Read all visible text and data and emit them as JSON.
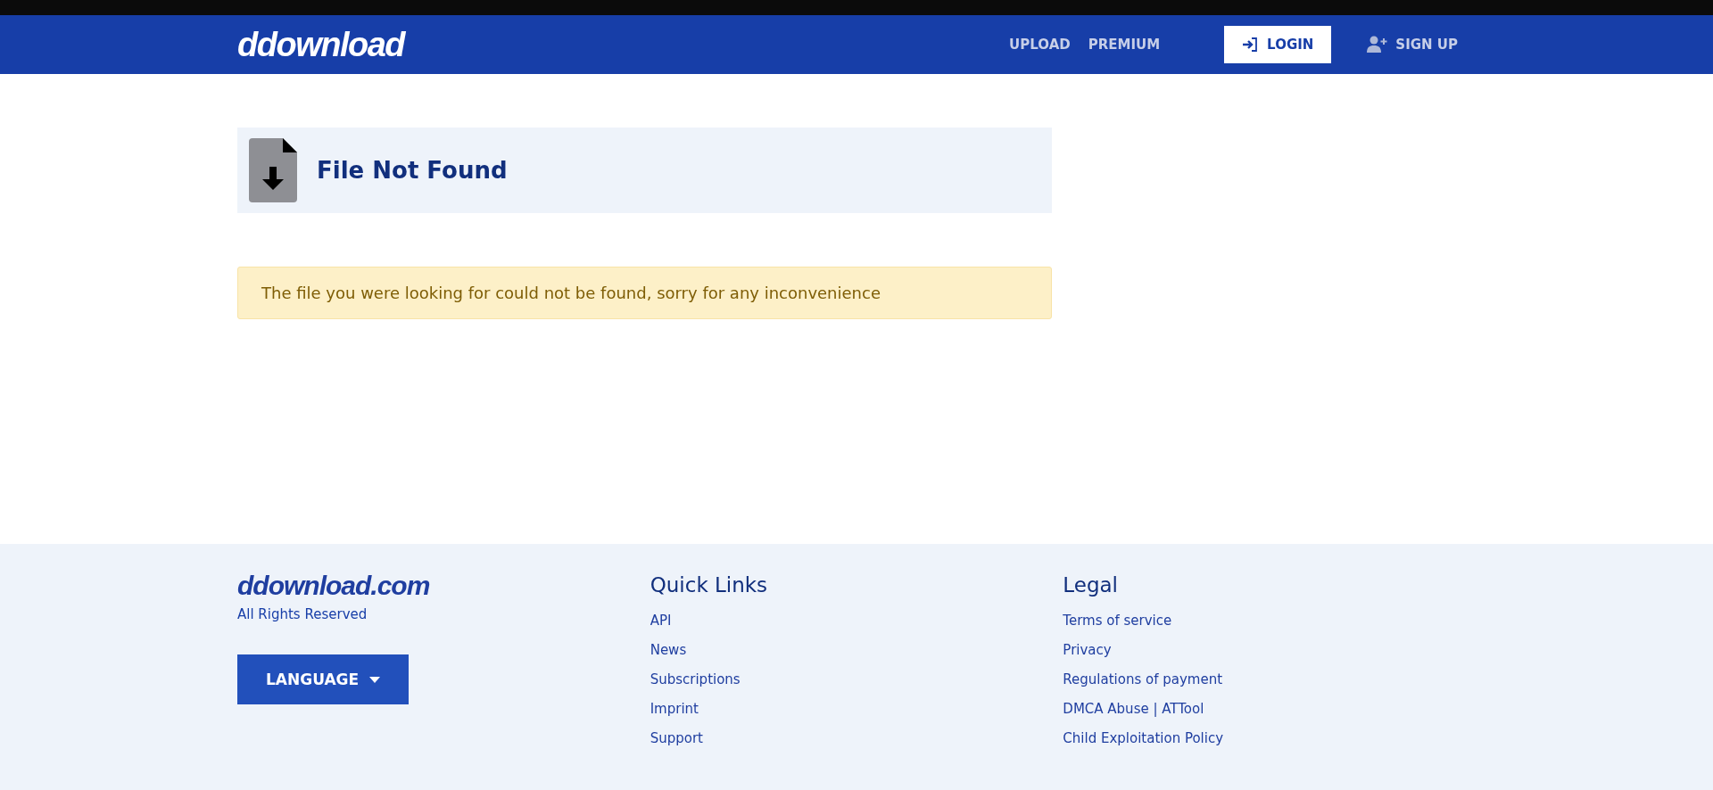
{
  "header": {
    "logo": "ddownload",
    "nav": [
      {
        "label": "UPLOAD",
        "kind": "link"
      },
      {
        "label": "PREMIUM",
        "kind": "link"
      },
      {
        "label": "LOGIN",
        "kind": "login"
      },
      {
        "label": "SIGN UP",
        "kind": "signup"
      }
    ]
  },
  "file_panel": {
    "title": "File Not Found"
  },
  "alert": {
    "message": "The file you were looking for could not be found, sorry for any inconvenience"
  },
  "footer": {
    "logo": "ddownload.com",
    "rights": "All Rights Reserved",
    "language_button": "LANGUAGE",
    "columns": [
      {
        "heading": "Quick Links",
        "links": [
          "API",
          "News",
          "Subscriptions",
          "Imprint",
          "Support"
        ]
      },
      {
        "heading": "Legal",
        "links": [
          "Terms of service",
          "Privacy",
          "Regulations of payment",
          "DMCA Abuse | ATTool",
          "Child Exploitation Policy"
        ]
      }
    ]
  }
}
